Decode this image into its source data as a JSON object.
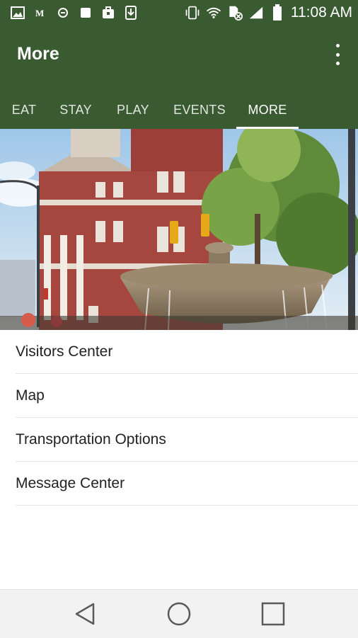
{
  "status_bar": {
    "time": "11:08 AM",
    "left_icons": [
      "image-icon",
      "gmail-icon",
      "settings-circle-icon",
      "stop-icon",
      "briefcase-icon",
      "download-icon"
    ],
    "right_icons": [
      "vibrate-icon",
      "wifi-icon",
      "sim-blocked-icon",
      "signal-icon",
      "battery-icon"
    ]
  },
  "app_bar": {
    "title": "More",
    "overflow_icon": "more-vert-icon",
    "color": "#3a5b31"
  },
  "tabs": [
    {
      "label": "EAT",
      "active": false
    },
    {
      "label": "STAY",
      "active": false
    },
    {
      "label": "PLAY",
      "active": false
    },
    {
      "label": "EVENTS",
      "active": false
    },
    {
      "label": "MORE",
      "active": true
    }
  ],
  "menu": {
    "items": [
      {
        "label": "Visitors Center"
      },
      {
        "label": "Map"
      },
      {
        "label": "Transportation Options"
      },
      {
        "label": "Message Center"
      }
    ]
  },
  "nav_bar": {
    "icons": [
      "back-icon",
      "home-icon",
      "recents-icon"
    ]
  }
}
